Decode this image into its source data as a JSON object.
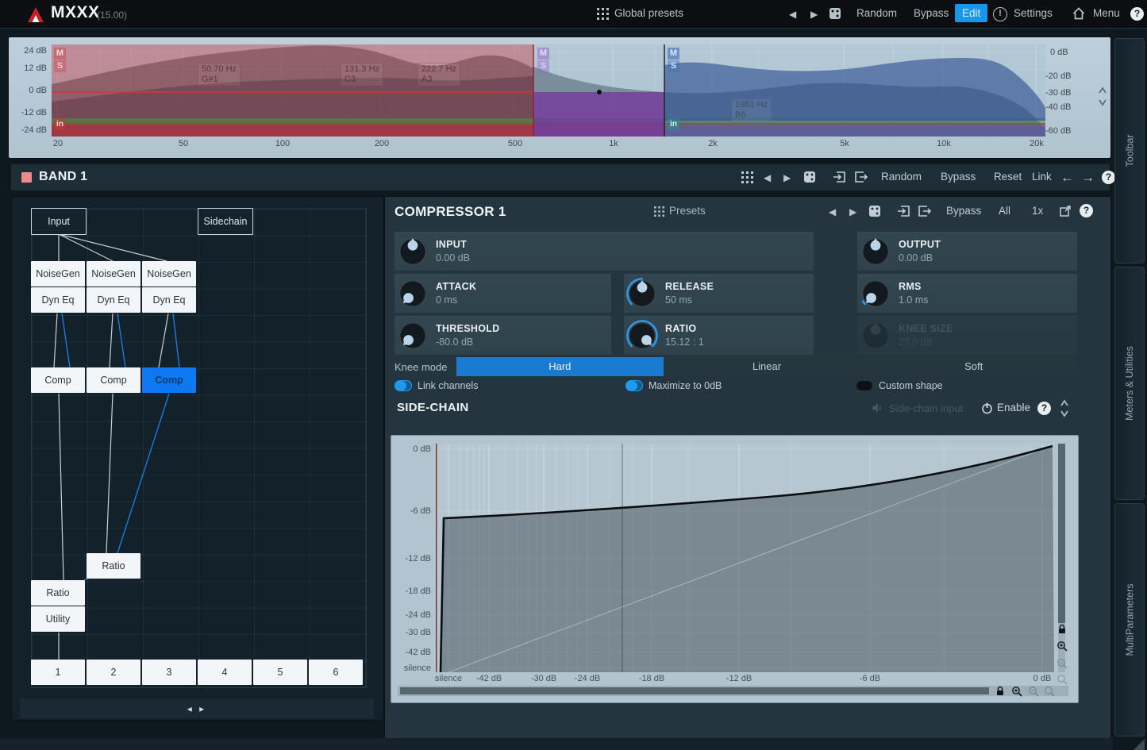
{
  "app": {
    "title": "MXXX",
    "version": "(15.00)"
  },
  "topbar": {
    "global_presets": "Global presets",
    "random": "Random",
    "bypass": "Bypass",
    "edit": "Edit",
    "settings": "Settings",
    "menu": "Menu"
  },
  "icons": {
    "prev": "◀",
    "next": "▶",
    "left_arrow": "←",
    "right_arrow": "→",
    "help": "?",
    "alert": "!",
    "m": "M",
    "s": "S",
    "in": "in",
    "collapse": "◂ ▸"
  },
  "spectrum": {
    "left_axis": [
      "24 dB",
      "12 dB",
      "0 dB",
      "-12 dB",
      "-24 dB"
    ],
    "right_axis": [
      "0 dB",
      "-20 dB",
      "-30 dB",
      "-40 dB",
      "-60 dB"
    ],
    "freq_axis": [
      "20",
      "50",
      "100",
      "200",
      "500",
      "1k",
      "2k",
      "5k",
      "10k",
      "20k"
    ],
    "band_labels": [
      {
        "freq": "50.70 Hz",
        "note": "G#1"
      },
      {
        "freq": "131.3 Hz",
        "note": "C3"
      },
      {
        "freq": "222.7 Hz",
        "note": "A3"
      },
      {
        "freq": "1981 Hz",
        "note": "B6"
      }
    ]
  },
  "band_bar": {
    "title": "BAND 1",
    "random": "Random",
    "bypass": "Bypass",
    "reset": "Reset",
    "link": "Link"
  },
  "matrix": {
    "input": "Input",
    "sidechain": "Sidechain",
    "noisegen": [
      "NoiseGen",
      "NoiseGen",
      "NoiseGen"
    ],
    "dyneq": [
      "Dyn Eq",
      "Dyn Eq",
      "Dyn Eq"
    ],
    "comp": [
      "Comp",
      "Comp",
      "Comp"
    ],
    "ratio_a": "Ratio",
    "ratio_b": "Ratio",
    "utility": "Utility",
    "slots": [
      "1",
      "2",
      "3",
      "4",
      "5",
      "6"
    ]
  },
  "compressor": {
    "title": "COMPRESSOR 1",
    "presets": "Presets",
    "bypass": "Bypass",
    "all": "All",
    "multiply": "1x",
    "knobs": [
      {
        "label": "INPUT",
        "value": "0.00 dB"
      },
      {
        "label": "OUTPUT",
        "value": "0.00 dB"
      },
      {
        "label": "ATTACK",
        "value": "0 ms"
      },
      {
        "label": "RELEASE",
        "value": "50 ms"
      },
      {
        "label": "RMS",
        "value": "1.0 ms"
      },
      {
        "label": "THRESHOLD",
        "value": "-80.0 dB"
      },
      {
        "label": "RATIO",
        "value": "15.12 : 1"
      },
      {
        "label": "KNEE SIZE",
        "value": "25.0 dB"
      }
    ],
    "knee_mode_label": "Knee mode",
    "knee_modes": [
      "Hard",
      "Linear",
      "Soft"
    ],
    "selected_knee_mode": "Hard",
    "toggles": [
      {
        "label": "Link channels",
        "on": true
      },
      {
        "label": "Maximize to 0dB",
        "on": true
      },
      {
        "label": "Custom shape",
        "on": false
      }
    ]
  },
  "sidechain": {
    "title": "SIDE-CHAIN",
    "input_label": "Side-chain input",
    "enable": "Enable",
    "graph": {
      "y_ticks": [
        "0 dB",
        "-6 dB",
        "-12 dB",
        "-18 dB",
        "-24 dB",
        "-30 dB",
        "-42 dB",
        "silence"
      ],
      "x_ticks": [
        "silence",
        "-42 dB",
        "-30 dB",
        "-24 dB",
        "-18 dB",
        "-12 dB",
        "-6 dB",
        "0 dB"
      ]
    }
  },
  "sidebar": {
    "tabs": [
      "Toolbar",
      "Meters & Utilities",
      "MultiParameters"
    ]
  }
}
